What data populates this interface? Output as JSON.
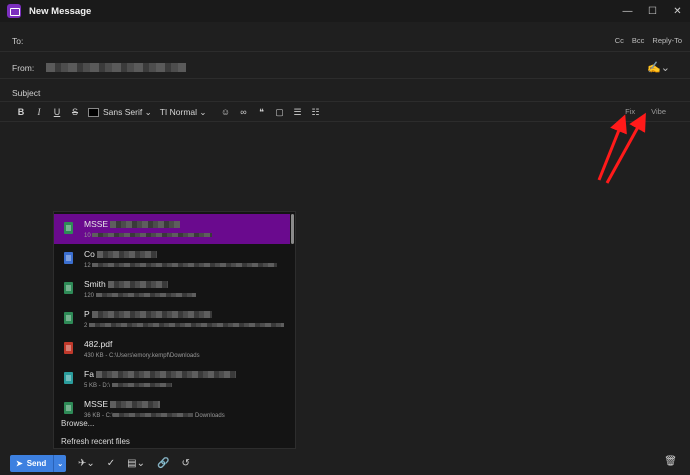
{
  "window": {
    "title": "New Message",
    "minimize_glyph": "—",
    "maximize_glyph": "☐",
    "close_glyph": "✕"
  },
  "fields": {
    "to_label": "To:",
    "from_label": "From:",
    "subject_placeholder": "Subject",
    "cc": "Cc",
    "bcc": "Bcc",
    "reply_to": "Reply-To"
  },
  "toolbar": {
    "bold": "B",
    "italic": "I",
    "underline": "U",
    "strike": "S",
    "text_color": "#000000",
    "font": "Sans Serif",
    "size": "Normal",
    "fix": "Fix",
    "vibe": "Vibe"
  },
  "dropdown": {
    "items": [
      {
        "name_prefix": "MSSE",
        "meta_prefix": "10",
        "icon": "spreadsheet-icon",
        "color": "#2e8b57",
        "selected": true
      },
      {
        "name_prefix": "Co",
        "meta_prefix": "12",
        "icon": "document-icon",
        "color": "#3b6fd0",
        "selected": false
      },
      {
        "name_prefix": "Smith",
        "meta_prefix": "120",
        "icon": "spreadsheet-icon",
        "color": "#2e8b57",
        "selected": false
      },
      {
        "name_prefix": "P",
        "meta_prefix": "2",
        "icon": "spreadsheet-icon",
        "color": "#2e8b57",
        "selected": false
      },
      {
        "name": "482.pdf",
        "meta": "430 KB - C:\\Users\\emory.kempf\\Downloads",
        "icon": "pdf-icon",
        "color": "#c0392b",
        "selected": false
      },
      {
        "name_prefix": "Fa",
        "meta_prefix": "5 KB - D:\\",
        "icon": "code-file-icon",
        "color": "#2a9d9d",
        "selected": false
      },
      {
        "name_prefix": "MSSE",
        "meta_prefix": "36 KB - C:\\",
        "meta_suffix": "Downloads",
        "icon": "spreadsheet-icon",
        "color": "#2e8b57",
        "selected": false
      }
    ],
    "browse": "Browse...",
    "refresh": "Refresh recent files"
  },
  "bottom": {
    "send": "Send"
  },
  "colors": {
    "selected_row": "#6a0a8e",
    "send_button": "#3d80e0",
    "arrow": "#ff1a1a"
  }
}
